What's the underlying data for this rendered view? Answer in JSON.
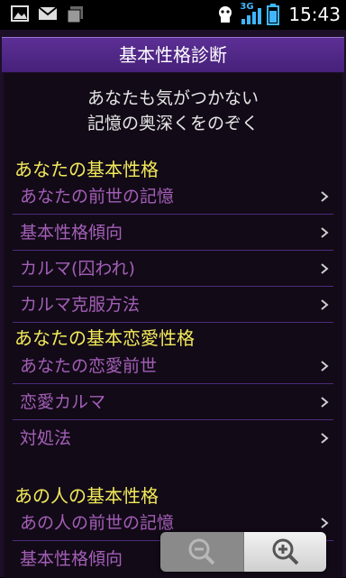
{
  "status_bar": {
    "left_icons": [
      "image-icon",
      "mail-icon",
      "notes-icon"
    ],
    "right_icons": [
      "android-icon",
      "signal-icon",
      "battery-icon"
    ],
    "network": "3G",
    "time": "15:43"
  },
  "app": {
    "title": "基本性格診断",
    "intro_line1": "あなたも気がつかない",
    "intro_line2": "記憶の奥深くをのぞく"
  },
  "sections": [
    {
      "header": "あなたの基本性格",
      "items": [
        "あなたの前世の記憶",
        "基本性格傾向",
        "カルマ(囚われ)",
        "カルマ克服方法"
      ]
    },
    {
      "header": "あなたの基本恋愛性格",
      "items": [
        "あなたの恋愛前世",
        "恋愛カルマ",
        "対処法"
      ]
    },
    {
      "header": "あの人の基本性格",
      "items": [
        "あの人の前世の記憶",
        "基本性格傾向"
      ]
    }
  ],
  "colors": {
    "title_bg": "#4d2483",
    "section_header": "#f2ea5a",
    "item_text": "#a35fb7",
    "divider": "#4b2c7a"
  },
  "zoom_control": {
    "zoom_out_icon": "zoom-out-icon",
    "zoom_in_icon": "zoom-in-icon"
  }
}
